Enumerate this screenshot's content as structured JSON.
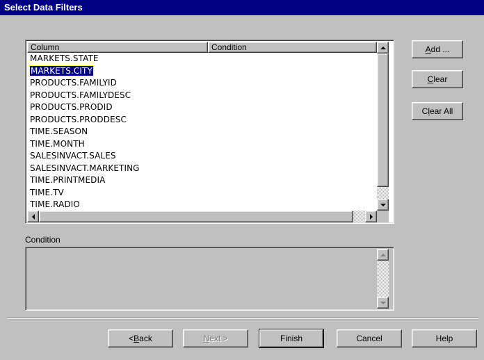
{
  "dialog": {
    "title": "Select Data Filters"
  },
  "listview": {
    "headers": [
      "Column",
      "Condition"
    ],
    "rows": [
      "MARKETS.STATE",
      "MARKETS.CITY",
      "PRODUCTS.FAMILYID",
      "PRODUCTS.FAMILYDESC",
      "PRODUCTS.PRODID",
      "PRODUCTS.PRODDESC",
      "TIME.SEASON",
      "TIME.MONTH",
      "SALESINVACT.SALES",
      "SALESINVACT.MARKETING",
      "TIME.PRINTMEDIA",
      "TIME.TV",
      "TIME.RADIO"
    ],
    "selected_index": 1
  },
  "side_buttons": {
    "add": {
      "pre": "",
      "key": "A",
      "post": "dd ..."
    },
    "clear": {
      "pre": "",
      "key": "C",
      "post": "lear"
    },
    "clear_all": {
      "pre": "C",
      "key": "l",
      "post": "ear All"
    }
  },
  "condition": {
    "label": "Condition",
    "value": ""
  },
  "nav_buttons": {
    "back": {
      "pre": "< ",
      "key": "B",
      "post": "ack"
    },
    "next": {
      "pre": "",
      "key": "N",
      "post": "ext >"
    },
    "finish": "Finish",
    "cancel": "Cancel",
    "help": "Help"
  },
  "icons": [
    "scroll-up-icon",
    "scroll-down-icon",
    "scroll-left-icon",
    "scroll-right-icon"
  ]
}
